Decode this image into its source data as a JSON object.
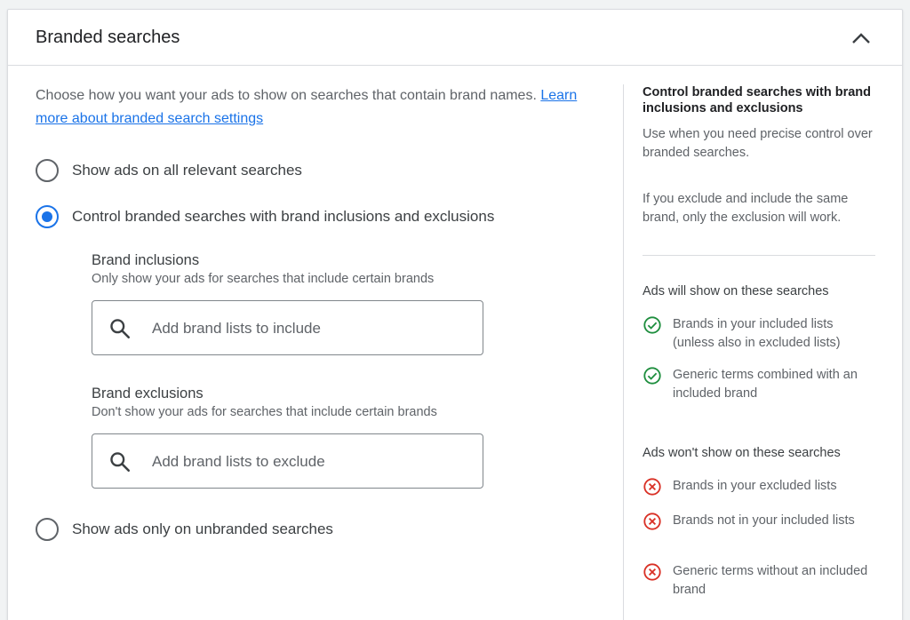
{
  "header": {
    "title": "Branded searches",
    "collapse_icon": "chevron-up-icon"
  },
  "main": {
    "intro_text": "Choose how you want your ads to show on searches that contain brand names.",
    "learn_more_link": "Learn more about branded search settings",
    "options": [
      {
        "label": "Show ads on all relevant searches",
        "checked": false
      },
      {
        "label": "Control branded searches with brand inclusions and exclusions",
        "checked": true
      },
      {
        "label": "Show ads only on unbranded searches",
        "checked": false
      }
    ],
    "inclusions": {
      "title": "Brand inclusions",
      "description": "Only show your ads for searches that include certain brands",
      "placeholder": "Add brand lists to include"
    },
    "exclusions": {
      "title": "Brand exclusions",
      "description": "Don't show your ads for searches that include certain brands",
      "placeholder": "Add brand lists to exclude"
    }
  },
  "side": {
    "title": "Control branded searches with brand inclusions and exclusions",
    "text1": "Use when you need precise control over branded searches.",
    "text2": "If you exclude and include the same brand, only the exclusion will work.",
    "will_show_heading": "Ads will show on these searches",
    "will_show": [
      "Brands in your included lists (unless also in excluded lists)",
      "Generic terms combined with an included brand"
    ],
    "wont_show_heading": "Ads won't show on these searches",
    "wont_show": [
      "Brands in your excluded lists",
      "Brands not in your included lists",
      "Generic terms without an included brand"
    ]
  },
  "colors": {
    "accent": "#1a73e8",
    "success": "#1e8e3e",
    "error": "#d93025"
  }
}
